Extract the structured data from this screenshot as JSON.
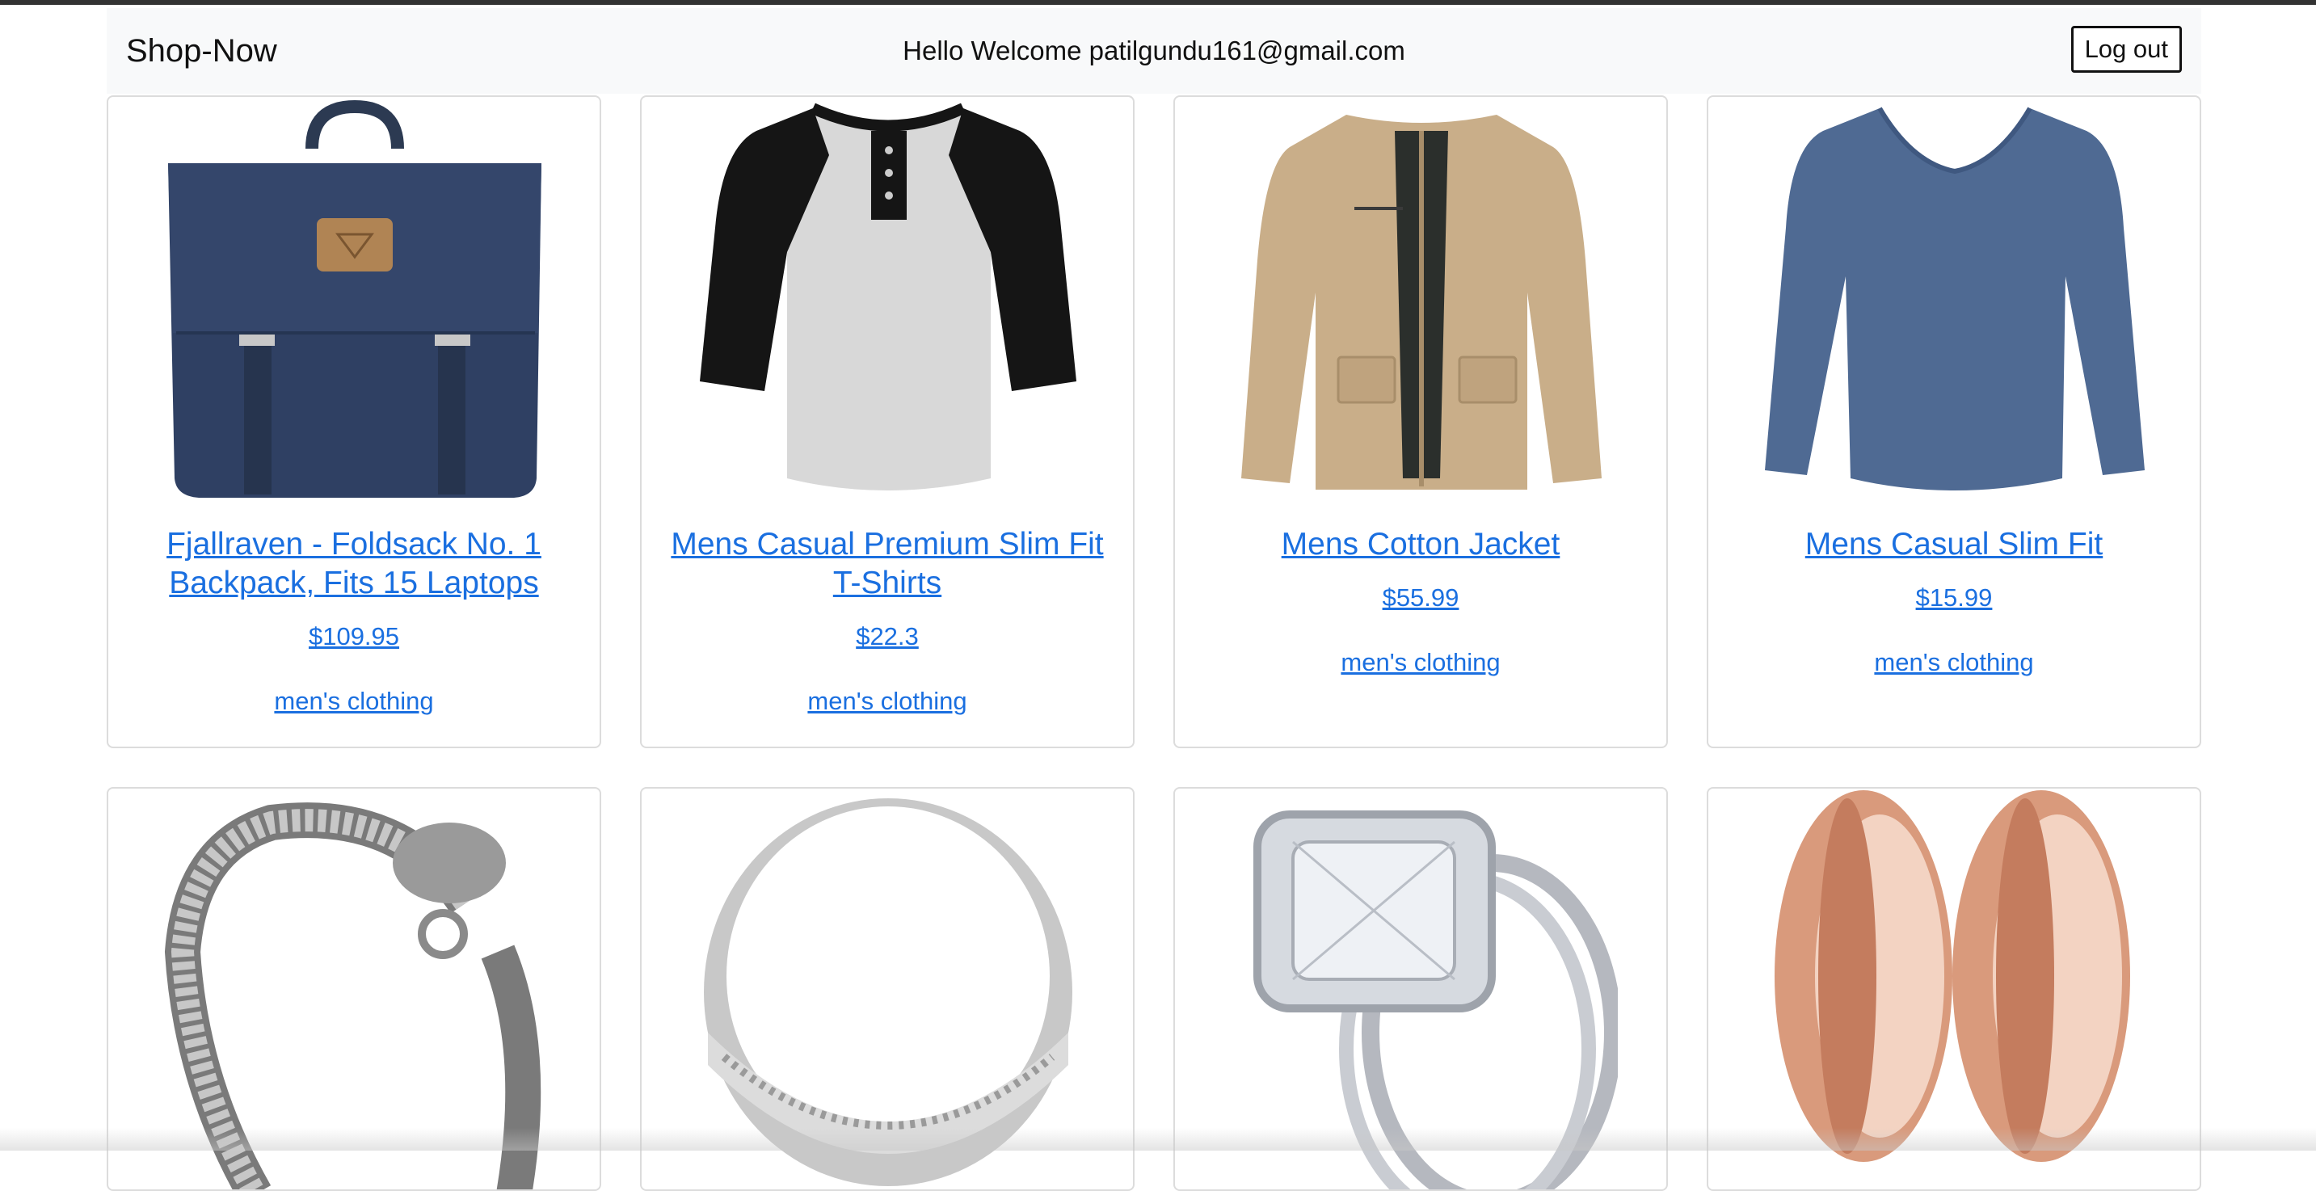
{
  "navbar": {
    "brand": "Shop-Now",
    "welcome": "Hello Welcome patilgundu161@gmail.com",
    "logout_label": "Log out"
  },
  "products": [
    {
      "title": "Fjallraven - Foldsack No. 1 Backpack, Fits 15 Laptops",
      "price": "$109.95",
      "category": "men's clothing",
      "image": "backpack-image"
    },
    {
      "title": "Mens Casual Premium Slim Fit T-Shirts",
      "price": "$22.3",
      "category": "men's clothing",
      "image": "raglan-tshirt-image"
    },
    {
      "title": "Mens Cotton Jacket",
      "price": "$55.99",
      "category": "men's clothing",
      "image": "jacket-image"
    },
    {
      "title": "Mens Casual Slim Fit",
      "price": "$15.99",
      "category": "men's clothing",
      "image": "longsleeve-shirt-image"
    },
    {
      "title": "",
      "price": "",
      "category": "",
      "image": "dragon-bracelet-image"
    },
    {
      "title": "",
      "price": "",
      "category": "",
      "image": "silver-ring-image"
    },
    {
      "title": "",
      "price": "",
      "category": "",
      "image": "diamond-ring-image"
    },
    {
      "title": "",
      "price": "",
      "category": "",
      "image": "rose-gold-tunnels-image"
    }
  ],
  "colors": {
    "link": "#1a6fe0",
    "navbar_bg": "#f8f9fa",
    "card_border": "#dcdcdc"
  }
}
